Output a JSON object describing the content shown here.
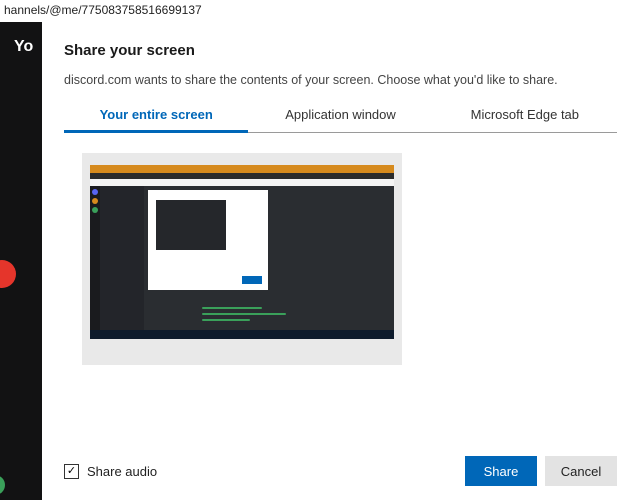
{
  "url_fragment": "hannels/@me/775083758516699137",
  "background_partial_text": "Yo",
  "modal": {
    "title": "Share your screen",
    "description": "discord.com wants to share the contents of your screen. Choose what you'd like to share.",
    "tabs": [
      {
        "label": "Your entire screen",
        "active": true
      },
      {
        "label": "Application window",
        "active": false
      },
      {
        "label": "Microsoft Edge tab",
        "active": false
      }
    ],
    "share_audio_label": "Share audio",
    "share_audio_checked": true,
    "share_button": "Share",
    "cancel_button": "Cancel"
  },
  "colors": {
    "accent": "#0067b8",
    "discord_dark": "#1e2124"
  }
}
